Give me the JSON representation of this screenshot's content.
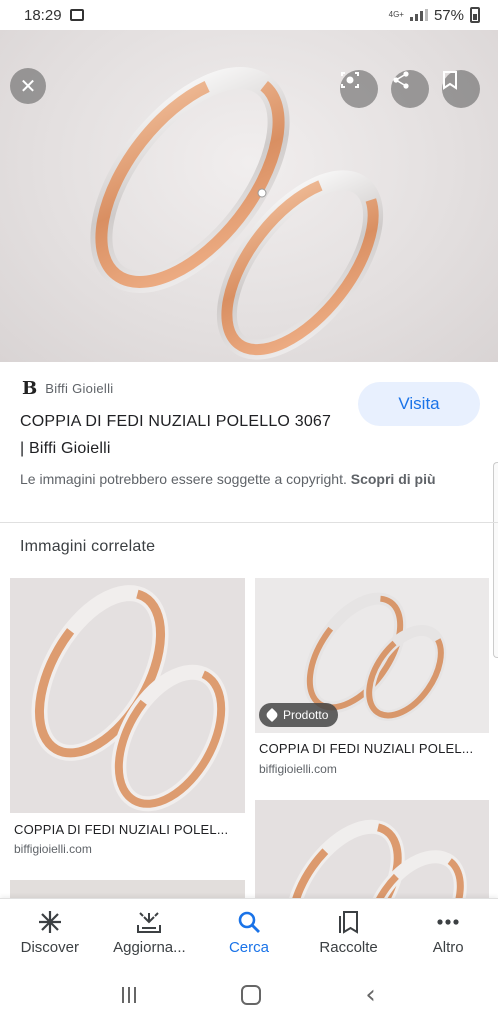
{
  "status_bar": {
    "time": "18:29",
    "network": "4G+",
    "battery": "57%"
  },
  "hero": {
    "close_icon": "close-icon",
    "lens_icon": "lens-icon",
    "share_icon": "share-icon",
    "bookmark_icon": "bookmark-icon"
  },
  "result": {
    "source_logo": "B",
    "source_name": "Biffi Gioielli",
    "title": "COPPIA DI FEDI NUZIALI POLELLO 3067 | Biffi Gioielli",
    "visit_label": "Visita",
    "copyright_text": "Le immagini potrebbero essere soggette a copyright.",
    "copyright_link": "Scopri di più"
  },
  "related": {
    "heading": "Immagini correlate",
    "items": [
      {
        "caption": "COPPIA DI FEDI NUZIALI POLEL...",
        "domain": "biffigioielli.com"
      },
      {
        "caption": "COPPIA DI FEDI NUZIALI POLEL...",
        "domain": "biffigioielli.com",
        "badge": "Prodotto"
      }
    ]
  },
  "bottom_nav": [
    {
      "label": "Discover",
      "icon": "asterisk-icon"
    },
    {
      "label": "Aggiorna...",
      "icon": "updates-icon"
    },
    {
      "label": "Cerca",
      "icon": "search-icon",
      "active": true
    },
    {
      "label": "Raccolte",
      "icon": "collections-icon"
    },
    {
      "label": "Altro",
      "icon": "more-icon"
    }
  ],
  "colors": {
    "accent": "#1a73e8",
    "visit_bg": "#e8f0fe",
    "rose_gold": "#e0a47c",
    "white_gold": "#e8e6e6"
  }
}
